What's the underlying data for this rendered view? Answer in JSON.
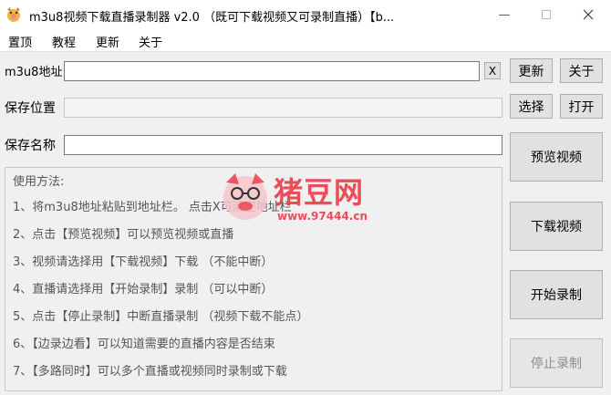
{
  "window": {
    "title": "m3u8视频下载直播录制器 v2.0 （既可下载视频又可录制直播）【b...",
    "minimize_icon": "minimize-icon",
    "maximize_icon": "maximize-icon",
    "close_icon": "close-icon"
  },
  "menu": {
    "items": [
      "置顶",
      "教程",
      "更新",
      "关于"
    ]
  },
  "form": {
    "url_label": "m3u8地址",
    "url_value": "",
    "clear_label": "X",
    "save_path_label": "保存位置",
    "save_path_value": "",
    "save_name_label": "保存名称",
    "save_name_value": ""
  },
  "buttons": {
    "update": "更新",
    "about": "关于",
    "choose": "选择",
    "open": "打开",
    "preview": "预览视频",
    "download": "下载视频",
    "start_record": "开始录制",
    "stop_record": "停止录制"
  },
  "usage": {
    "title": "使用方法:",
    "lines": [
      "1、将m3u8地址粘贴到地址栏。  点击X可清空地址栏",
      "2、点击【预览视频】可以预览视频或直播",
      "3、视频请选择用【下载视频】下载  （不能中断）",
      "4、直播请选择用【开始录制】录制  （可以中断）",
      "5、点击【停止录制】中断直播录制  （视频下载不能点）",
      "6、【边录边看】可以知道需要的直播内容是否结束",
      "7、【多路同时】可以多个直播或视频同时录制或下载"
    ]
  },
  "watermark": {
    "name": "猪豆网",
    "url": "www.97444.cn"
  },
  "colors": {
    "accent": "#e8404c",
    "window_bg": "#f0f0f0",
    "button_bg": "#e1e1e1"
  }
}
